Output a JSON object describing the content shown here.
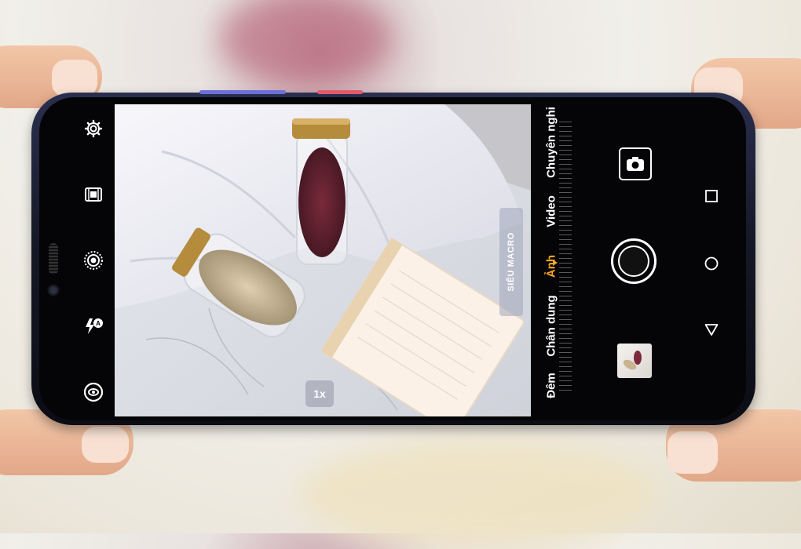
{
  "camera": {
    "zoom_label": "1x",
    "macro_chip_label": "SIÊU MACRO",
    "modes": [
      {
        "label": "Đêm",
        "active": false
      },
      {
        "label": "Chân dung",
        "active": false
      },
      {
        "label": "Ảnh",
        "active": true
      },
      {
        "label": "Video",
        "active": false
      },
      {
        "label": "Chuyên nghi",
        "active": false
      }
    ],
    "left_toolbar_icons": [
      "settings-icon",
      "filmstrip-icon",
      "live-photo-icon",
      "auto-flash-icon",
      "lens-icon"
    ],
    "right_panel_icons": [
      "switch-camera-icon",
      "shutter-button",
      "gallery-thumbnail"
    ],
    "nav_icons": [
      "nav-recent-icon",
      "nav-home-icon",
      "nav-back-icon"
    ],
    "accent_color": "#f5a623"
  }
}
